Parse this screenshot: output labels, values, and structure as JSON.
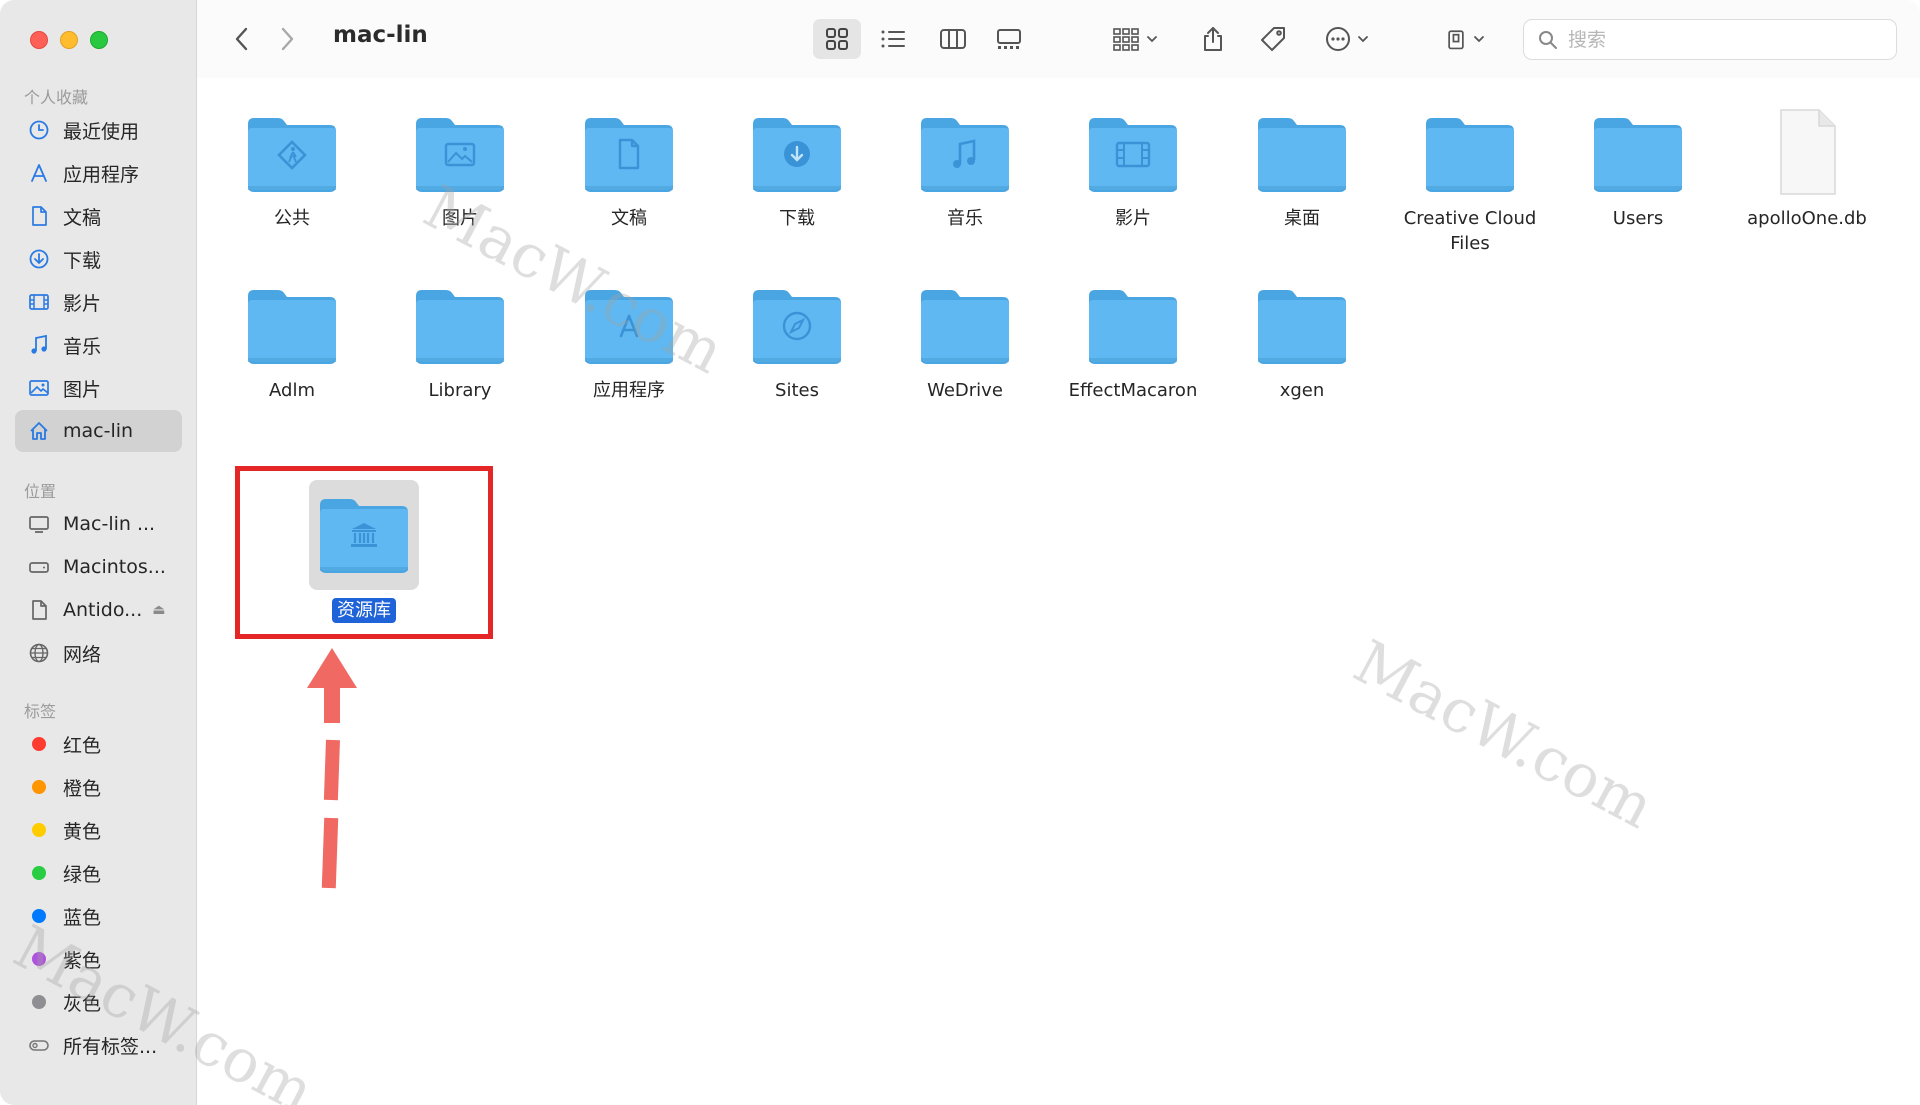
{
  "window": {
    "title": "mac-lin"
  },
  "sidebar": {
    "favorites_header": "个人收藏",
    "favorites": [
      {
        "label": "最近使用",
        "icon": "clock-icon"
      },
      {
        "label": "应用程序",
        "icon": "apps-icon"
      },
      {
        "label": "文稿",
        "icon": "document-icon"
      },
      {
        "label": "下载",
        "icon": "download-icon"
      },
      {
        "label": "影片",
        "icon": "film-icon"
      },
      {
        "label": "音乐",
        "icon": "music-icon"
      },
      {
        "label": "图片",
        "icon": "photo-icon"
      },
      {
        "label": "mac-lin",
        "icon": "home-icon",
        "selected": true
      }
    ],
    "locations_header": "位置",
    "locations": [
      {
        "label": "Mac-lin ...",
        "icon": "computer-icon"
      },
      {
        "label": "Macintos...",
        "icon": "disk-icon"
      },
      {
        "label": "Antido...",
        "icon": "file-icon",
        "eject": true
      },
      {
        "label": "网络",
        "icon": "globe-icon"
      }
    ],
    "tags_header": "标签",
    "tags": [
      {
        "label": "红色",
        "color": "#ff3b30"
      },
      {
        "label": "橙色",
        "color": "#ff9500"
      },
      {
        "label": "黄色",
        "color": "#ffcc00"
      },
      {
        "label": "绿色",
        "color": "#28cd41"
      },
      {
        "label": "蓝色",
        "color": "#007aff"
      },
      {
        "label": "紫色",
        "color": "#af52de"
      },
      {
        "label": "灰色",
        "color": "#8e8e93"
      },
      {
        "label": "所有标签...",
        "color": ""
      }
    ]
  },
  "toolbar": {
    "back_icon": "chevron-left-icon",
    "forward_icon": "chevron-right-icon",
    "search_placeholder": "搜索"
  },
  "files": [
    {
      "name": "公共",
      "type": "folder",
      "glyph": "public"
    },
    {
      "name": "图片",
      "type": "folder",
      "glyph": "photo"
    },
    {
      "name": "文稿",
      "type": "folder",
      "glyph": "doc"
    },
    {
      "name": "下载",
      "type": "folder",
      "glyph": "download"
    },
    {
      "name": "音乐",
      "type": "folder",
      "glyph": "music"
    },
    {
      "name": "影片",
      "type": "folder",
      "glyph": "film"
    },
    {
      "name": "桌面",
      "type": "folder",
      "glyph": ""
    },
    {
      "name": "Creative Cloud Files",
      "type": "folder",
      "glyph": ""
    },
    {
      "name": "Users",
      "type": "folder",
      "glyph": ""
    },
    {
      "name": "apolloOne.db",
      "type": "file",
      "glyph": ""
    },
    {
      "name": "Adlm",
      "type": "folder",
      "glyph": ""
    },
    {
      "name": "Library",
      "type": "folder",
      "glyph": ""
    },
    {
      "name": "应用程序",
      "type": "folder",
      "glyph": "apps"
    },
    {
      "name": "Sites",
      "type": "folder",
      "glyph": "compass"
    },
    {
      "name": "WeDrive",
      "type": "folder",
      "glyph": ""
    },
    {
      "name": "EffectMacaron",
      "type": "folder",
      "glyph": ""
    },
    {
      "name": "xgen",
      "type": "folder",
      "glyph": ""
    }
  ],
  "selected_file": {
    "name": "资源库",
    "type": "folder",
    "glyph": "library"
  },
  "colors": {
    "folder": "#5fb8f2",
    "folder_dark": "#4aa6e3",
    "glyph": "#3a93d6",
    "highlight": "#e52626",
    "selection": "#1f63d9"
  }
}
